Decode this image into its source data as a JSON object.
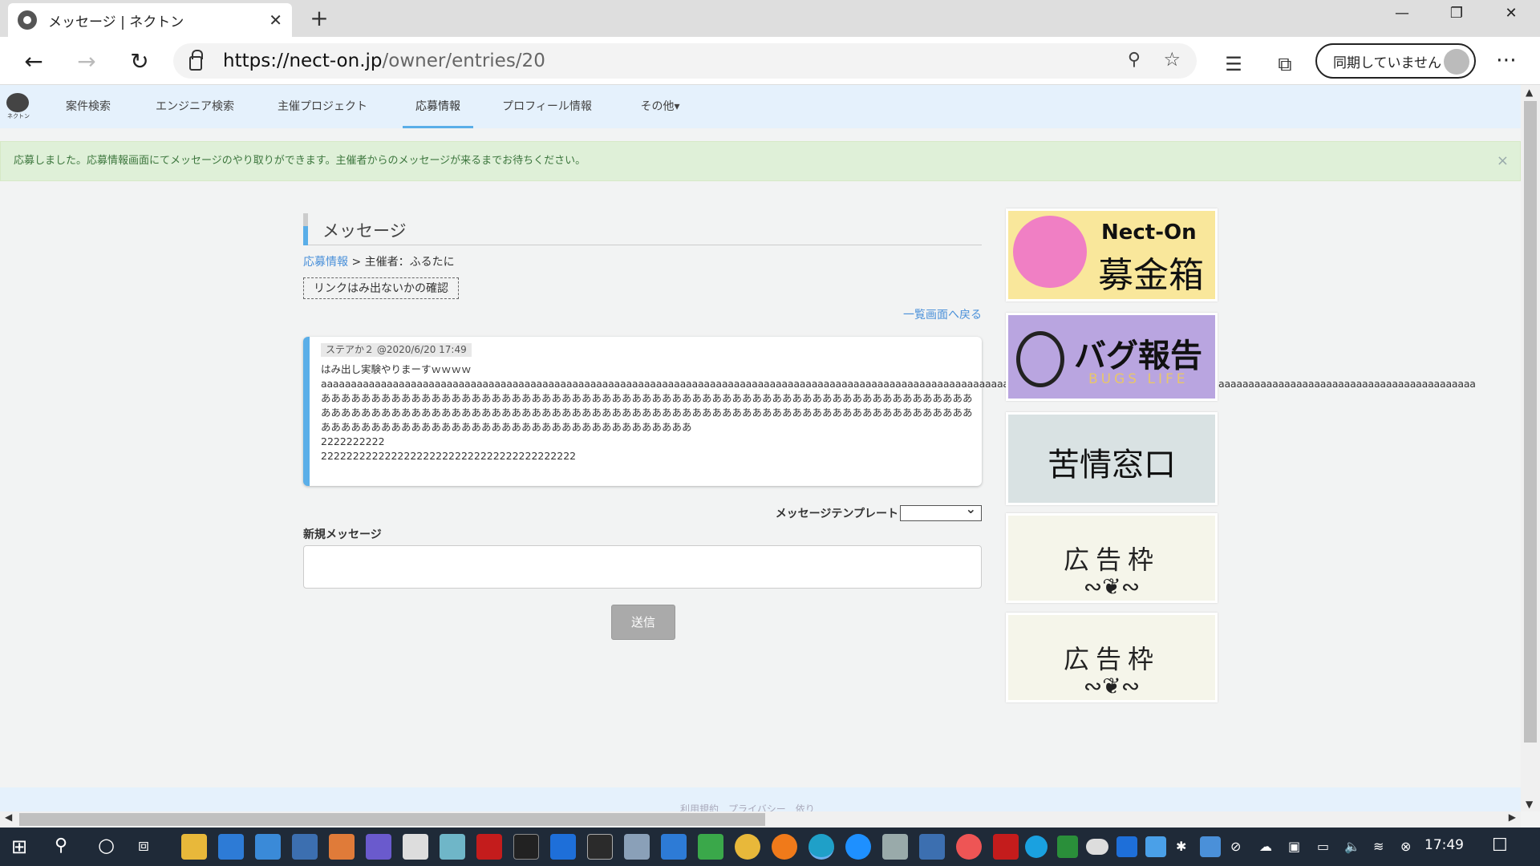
{
  "browser": {
    "tab_title": "メッセージ | ネクトン",
    "url_host": "https://nect-on.jp",
    "url_path": "/owner/entries/20",
    "sync_label": "同期していません"
  },
  "nav": {
    "logo_text": "ネクトン",
    "items": [
      "案件検索",
      "エンジニア検索",
      "主催プロジェクト",
      "応募情報",
      "プロフィール情報",
      "その他▾"
    ]
  },
  "alert": {
    "text": "応募しました。応募情報画面にてメッセージのやり取りができます。主催者からのメッセージが来るまでお待ちください。",
    "close": "×"
  },
  "page": {
    "heading": "メッセージ",
    "breadcrumb_link": "応募情報",
    "breadcrumb_rest": " > 主催者：ふるたに",
    "subject": "リンクはみ出ないかの確認",
    "back_link": "一覧画面へ戻る"
  },
  "message": {
    "meta": "ステアか２ @2020/6/20 17:49",
    "line1": "はみ出し実験やりまーすｗｗｗｗ",
    "line2": "aaaaaaaaaaaaaaaaaaaaaaaaaaaaaaaaaaaaaaaaaaaaaaaaaaaaaaaaaaaaaaaaaaaaaaaaaaaaaaaaaaaaaaaaaaaaaaaaaaaaaaaaaaaaaaaaaaaaaaaaaaaaaaaaaaaaaaaaaaaaaaaaaaaaaaaaaaaaaaaaaaaaaaaaaaaaaaaaaaaaaaaaaaaaaaaaa",
    "line3": "あああああああああああああああああああああああああああああああああああああああああああああああああああああああああああああああああああああああああああああああああああああああああああああああああああああああああああああああああああああああああああああああああああああああああああああああああああああああああああああああああああああああ",
    "line4": "2222222222",
    "line5": "2222222222222222222222222222222222222222"
  },
  "form": {
    "template_label": "メッセージテンプレート",
    "new_label": "新規メッセージ",
    "send_label": "送信"
  },
  "banners": {
    "b1_title": "Nect-On",
    "b1_sub": "募金箱",
    "b2_title": "バグ報告",
    "b2_sub": "BUGS LIFE",
    "b3_title": "苦情窓口",
    "ad_title": "広告枠"
  },
  "footer": {
    "links": "利用規約　プライバシー　依り"
  },
  "taskbar": {
    "time": "17:49"
  }
}
